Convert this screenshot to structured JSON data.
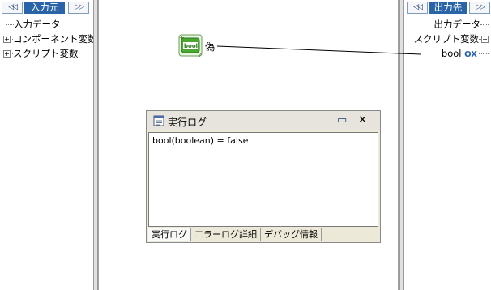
{
  "left_panel": {
    "header": "入力元",
    "nav_prev": "◁◁",
    "nav_next": "▷▷",
    "items": [
      {
        "label": "入力データ",
        "expander": ""
      },
      {
        "label": "コンポーネント変数",
        "expander": "+"
      },
      {
        "label": "スクリプト変数",
        "expander": "+"
      }
    ]
  },
  "right_panel": {
    "header": "出力先",
    "nav_prev": "◁◁",
    "nav_next": "▷▷",
    "items": [
      {
        "label": "出力データ",
        "expander": ""
      },
      {
        "label": "スクリプト変数",
        "expander": "−"
      },
      {
        "label": "bool",
        "badge": "OX"
      }
    ]
  },
  "canvas": {
    "node_label": "偽",
    "node_icon_text": "bool"
  },
  "log_dialog": {
    "title": "実行ログ",
    "minimize_glyph": "▭",
    "close_glyph": "✕",
    "content": "bool(boolean) = false",
    "tabs": [
      "実行ログ",
      "エラーログ詳細",
      "デバッグ情報"
    ]
  },
  "colors": {
    "header_bg": "#2a64a8",
    "badge": "#2a64a8",
    "icon_green": "#4aa832"
  }
}
